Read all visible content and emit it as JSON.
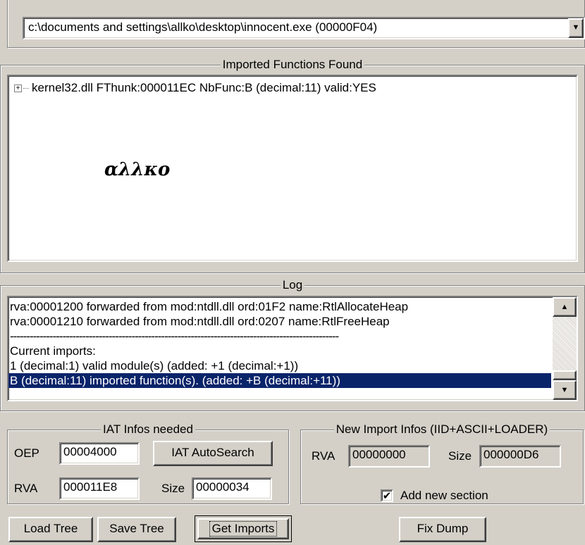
{
  "process_select": {
    "value": "c:\\documents and settings\\allko\\desktop\\innocent.exe (00000F04)",
    "arrow": "▼"
  },
  "imports_group": {
    "title": "Imported Functions Found",
    "tree_items": [
      {
        "expander": "+",
        "label": "kernel32.dll FThunk:000011EC NbFunc:B (decimal:11) valid:YES"
      }
    ],
    "watermark": "αλλκο"
  },
  "log_group": {
    "title": "Log",
    "lines": [
      "rva:00001200 forwarded from mod:ntdll.dll ord:01F2 name:RtlAllocateHeap",
      "rva:00001210 forwarded from mod:ntdll.dll ord:0207 name:RtlFreeHeap",
      "----------------------------------------------------------------------------------------------------",
      "Current imports:",
      "1 (decimal:1) valid module(s) (added: +1 (decimal:+1))",
      "B (decimal:11) imported function(s). (added: +B (decimal:+11))"
    ],
    "selected_index": 5,
    "scroll_up": "▲",
    "scroll_down": "▼"
  },
  "iat_group": {
    "title": "IAT Infos needed",
    "oep_label": "OEP",
    "oep_value": "00004000",
    "autosearch_label": "IAT AutoSearch",
    "rva_label": "RVA",
    "rva_value": "000011E8",
    "size_label": "Size",
    "size_value": "00000034"
  },
  "new_import_group": {
    "title": "New Import Infos (IID+ASCII+LOADER)",
    "rva_label": "RVA",
    "rva_value": "00000000",
    "size_label": "Size",
    "size_value": "000000D6",
    "add_section_label": "Add new section",
    "add_section_checked": true,
    "check_mark": "✔"
  },
  "bottom_buttons": {
    "load_tree": "Load Tree",
    "save_tree": "Save Tree",
    "get_imports": "Get Imports",
    "fix_dump": "Fix Dump"
  }
}
